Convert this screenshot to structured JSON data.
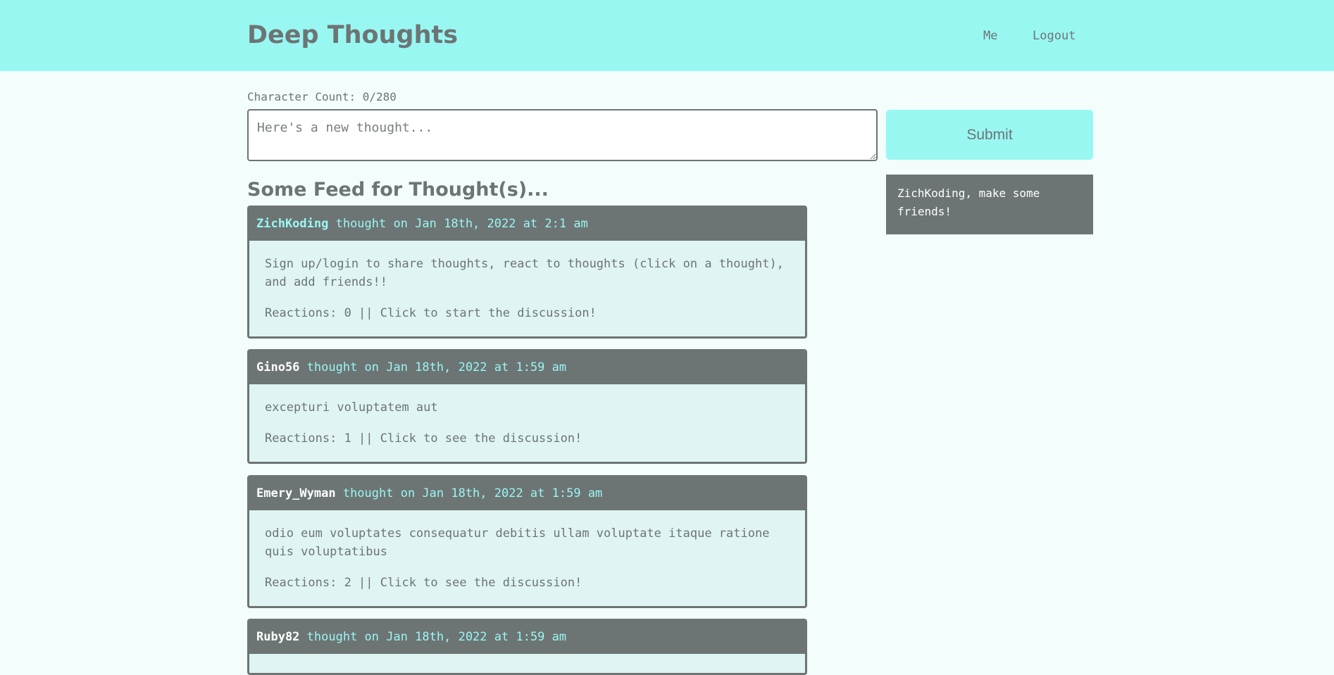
{
  "header": {
    "brand": "Deep Thoughts",
    "nav": {
      "me": "Me",
      "logout": "Logout"
    },
    "background_color": "#99f7f2"
  },
  "thought_form": {
    "character_count": "Character Count: 0/280",
    "placeholder": "Here's a new thought...",
    "value": "",
    "submit_label": "Submit"
  },
  "friends_panel": {
    "message": "ZichKoding, make some friends!"
  },
  "feed": {
    "title": "Some Feed for Thought(s)...",
    "thoughts": [
      {
        "username": "ZichKoding",
        "meta": " thought on Jan 18th, 2022 at 2:1 am",
        "text": "Sign up/login to share thoughts, react to thoughts (click on a thought), and add friends!!",
        "reactions": "Reactions: 0 || Click to start the discussion!"
      },
      {
        "username": "Gino56",
        "meta": " thought on Jan 18th, 2022 at 1:59 am",
        "text": "excepturi voluptatem aut",
        "reactions": "Reactions: 1 || Click to see the discussion!"
      },
      {
        "username": "Emery_Wyman",
        "meta": " thought on Jan 18th, 2022 at 1:59 am",
        "text": "odio eum voluptates consequatur debitis ullam voluptate itaque ratione quis voluptatibus",
        "reactions": "Reactions: 2 || Click to see the discussion!"
      },
      {
        "username": "Ruby82",
        "meta": " thought on Jan 18th, 2022 at 1:59 am"
      }
    ]
  },
  "colors": {
    "accent": "#99f7f2",
    "text": "#6d7474",
    "page_background": "#f3fefc",
    "card_background": "#e0f5f3"
  }
}
